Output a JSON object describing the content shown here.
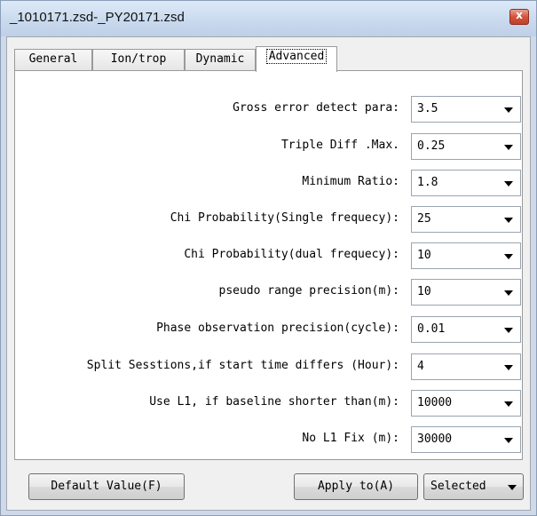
{
  "window": {
    "title": "_1010171.zsd-_PY20171.zsd",
    "close_glyph": "x"
  },
  "tabs": [
    {
      "label": "General"
    },
    {
      "label": "Ion/trop"
    },
    {
      "label": "Dynamic"
    },
    {
      "label": "Advanced"
    }
  ],
  "active_tab": "Advanced",
  "settings": [
    {
      "label": "Gross error detect para:",
      "value": "3.5"
    },
    {
      "label": "Triple Diff .Max.",
      "value": "0.25"
    },
    {
      "label": "Minimum Ratio:",
      "value": "1.8"
    },
    {
      "label": "Chi Probability(Single frequecy):",
      "value": "25"
    },
    {
      "label": "Chi Probability(dual frequecy):",
      "value": "10"
    },
    {
      "label": "pseudo range precision(m):",
      "value": "10"
    },
    {
      "label": "Phase observation precision(cycle):",
      "value": "0.01"
    },
    {
      "label": "Split Sesstions,if start time differs (Hour):",
      "value": "4"
    },
    {
      "label": "Use L1, if baseline shorter than(m):",
      "value": "10000"
    },
    {
      "label": "No L1 Fix (m):",
      "value": "30000"
    }
  ],
  "buttons": {
    "default_value": "Default Value(F)",
    "apply_to": "Apply to(A)"
  },
  "apply_target": {
    "value": "Selected"
  },
  "icons": {
    "close": "close-icon",
    "dropdown": "chevron-down-icon"
  }
}
